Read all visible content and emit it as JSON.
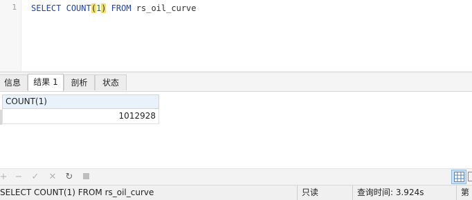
{
  "editor": {
    "line_number": "1",
    "kw_select": "SELECT",
    "fn_count": "COUNT",
    "paren_open": "(",
    "arg": "1",
    "paren_close": ")",
    "kw_from": "FROM",
    "table_name": "rs_oil_curve"
  },
  "tabs": [
    {
      "label": "信息",
      "active": false
    },
    {
      "label": "结果 1",
      "active": true
    },
    {
      "label": "剖析",
      "active": false
    },
    {
      "label": "状态",
      "active": false
    }
  ],
  "result": {
    "columns": [
      "COUNT(1)"
    ],
    "rows": [
      [
        "1012928"
      ]
    ]
  },
  "toolbar": {
    "add_icon": "plus-icon",
    "remove_icon": "minus-icon",
    "apply_icon": "check-icon",
    "discard_icon": "x-icon",
    "refresh_icon": "refresh-icon",
    "stop_icon": "stop-icon",
    "grid_view_icon": "grid-view-icon",
    "form_view_icon": "form-view-icon"
  },
  "status": {
    "query_text": "SELECT COUNT(1) FROM rs_oil_curve",
    "mode": "只读",
    "query_time": "查询时间: 3.924s",
    "record_prefix": "第"
  },
  "colors": {
    "keyword": "#1d3fc2",
    "number": "#1a7c1a",
    "paren_highlight": "#f2e070",
    "grid_header": "#e9f1fb"
  }
}
